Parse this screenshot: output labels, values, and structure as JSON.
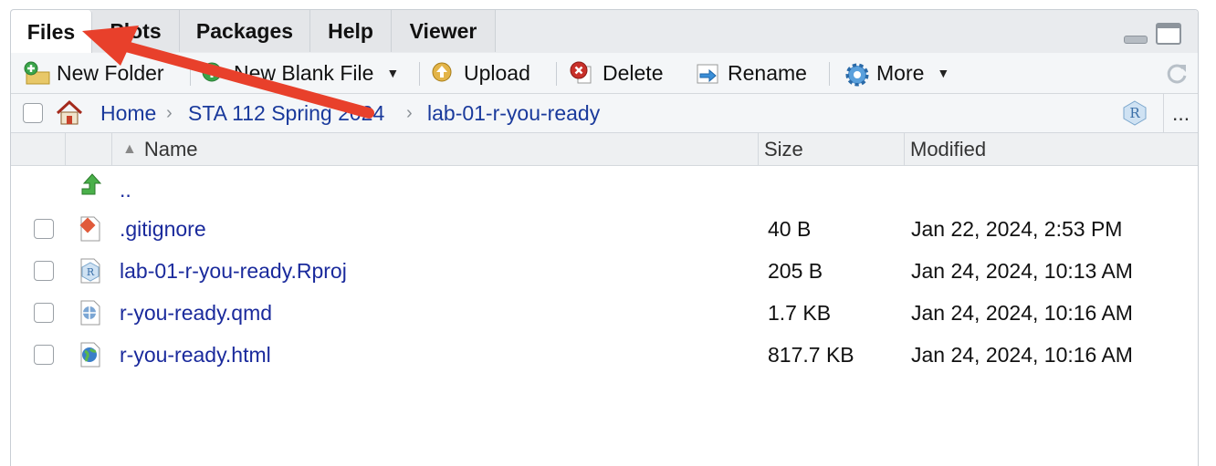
{
  "tabs": [
    {
      "label": "Files",
      "active": true
    },
    {
      "label": "Plots",
      "active": false
    },
    {
      "label": "Packages",
      "active": false
    },
    {
      "label": "Help",
      "active": false
    },
    {
      "label": "Viewer",
      "active": false
    }
  ],
  "toolbar": {
    "new_folder": "New Folder",
    "new_blank_file": "New Blank File",
    "upload": "Upload",
    "delete": "Delete",
    "rename": "Rename",
    "more": "More"
  },
  "breadcrumb": {
    "home": "Home",
    "items": [
      "STA 112 Spring 2024",
      "lab-01-r-you-ready"
    ],
    "overflow": "..."
  },
  "table": {
    "columns": {
      "name": "Name",
      "size": "Size",
      "modified": "Modified"
    },
    "parent_link": "..",
    "rows": [
      {
        "icon": "git-file-icon",
        "name": ".gitignore",
        "size": "40 B",
        "modified": "Jan 22, 2024, 2:53 PM"
      },
      {
        "icon": "rproj-file-icon",
        "name": "lab-01-r-you-ready.Rproj",
        "size": "205 B",
        "modified": "Jan 24, 2024, 10:13 AM"
      },
      {
        "icon": "quarto-file-icon",
        "name": "r-you-ready.qmd",
        "size": "1.7 KB",
        "modified": "Jan 24, 2024, 10:16 AM"
      },
      {
        "icon": "html-file-icon",
        "name": "r-you-ready.html",
        "size": "817.7 KB",
        "modified": "Jan 24, 2024, 10:16 AM"
      }
    ]
  },
  "colors": {
    "link": "#1a2a9c",
    "annotation_arrow": "#e8402b"
  }
}
